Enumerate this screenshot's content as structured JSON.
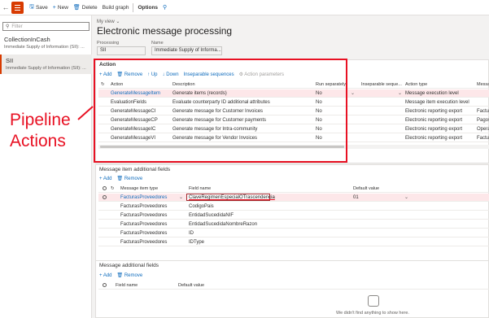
{
  "toolbar": {
    "back_icon": "back-arrow-icon",
    "save": "Save",
    "new": "New",
    "delete": "Delete",
    "build_graph": "Build graph",
    "options": "Options"
  },
  "left": {
    "filter_placeholder": "Filter",
    "records": [
      {
        "title": "CollectionInCash",
        "subtitle": "Immediate Supply of Information (SII): ..."
      },
      {
        "title": "SII",
        "subtitle": "Immediate Supply of Information (SII): ..."
      }
    ]
  },
  "header": {
    "my_view": "My view",
    "title": "Electronic message processing",
    "processing_label": "Processing",
    "processing_value": "SII",
    "name_label": "Name",
    "name_value": "Immediate Supply of Informa..."
  },
  "action": {
    "title": "Action",
    "toolbar": {
      "add": "Add",
      "remove": "Remove",
      "up": "Up",
      "down": "Down",
      "inseparable": "Inseparable sequences",
      "params": "Action parameters"
    },
    "columns": [
      "Action",
      "Description",
      "Run separately",
      "Inseparable seque...",
      "Action type",
      "Messa"
    ],
    "rows": [
      {
        "action": "GenerateMessageItem",
        "description": "Generate items (records)",
        "run": "No",
        "inseparable": "",
        "type": "Message execution level",
        "message": ""
      },
      {
        "action": "EvaluationFields",
        "description": "Evaluate counterparty ID additional attributes",
        "run": "No",
        "inseparable": "",
        "type": "Message item execution level",
        "message": ""
      },
      {
        "action": "GenerateMessageCI",
        "description": "Generate message for Customer Invoices",
        "run": "No",
        "inseparable": "",
        "type": "Electronic reporting export",
        "message": "Factu"
      },
      {
        "action": "GenerateMessageCP",
        "description": "Generate message for Customer payments",
        "run": "No",
        "inseparable": "",
        "type": "Electronic reporting export",
        "message": "Pagos"
      },
      {
        "action": "GenerateMessageIC",
        "description": "Generate message for Intra-community",
        "run": "No",
        "inseparable": "",
        "type": "Electronic reporting export",
        "message": "Opera"
      },
      {
        "action": "GenerateMessageVI",
        "description": "Generate message for Vendor Invoices",
        "run": "No",
        "inseparable": "",
        "type": "Electronic reporting export",
        "message": "Factu"
      }
    ]
  },
  "annotation": {
    "line1": "Pipeline",
    "line2": "Actions"
  },
  "item_fields": {
    "title": "Message item additional fields",
    "toolbar": {
      "add": "Add",
      "remove": "Remove"
    },
    "columns": [
      "Message item type",
      "Field name",
      "Default value"
    ],
    "rows": [
      {
        "type": "FacturasProveedores",
        "field": "ClaveRegimenEspecialOTrascendencia",
        "value": "01"
      },
      {
        "type": "FacturasProveedores",
        "field": "CodigoPais",
        "value": ""
      },
      {
        "type": "FacturasProveedores",
        "field": "EntidadSucedidaNIF",
        "value": ""
      },
      {
        "type": "FacturasProveedores",
        "field": "EntidadSucedidaNombreRazon",
        "value": ""
      },
      {
        "type": "FacturasProveedores",
        "field": "ID",
        "value": ""
      },
      {
        "type": "FacturasProveedores",
        "field": "IDType",
        "value": ""
      }
    ]
  },
  "message_fields": {
    "title": "Message additional fields",
    "toolbar": {
      "add": "Add",
      "remove": "Remove"
    },
    "columns": [
      "Field name",
      "Default value"
    ],
    "empty_text": "We didn't find anything to show here."
  },
  "colors": {
    "accent": "#d83b01",
    "link": "#0f6cbd",
    "annotation": "#e81123"
  }
}
